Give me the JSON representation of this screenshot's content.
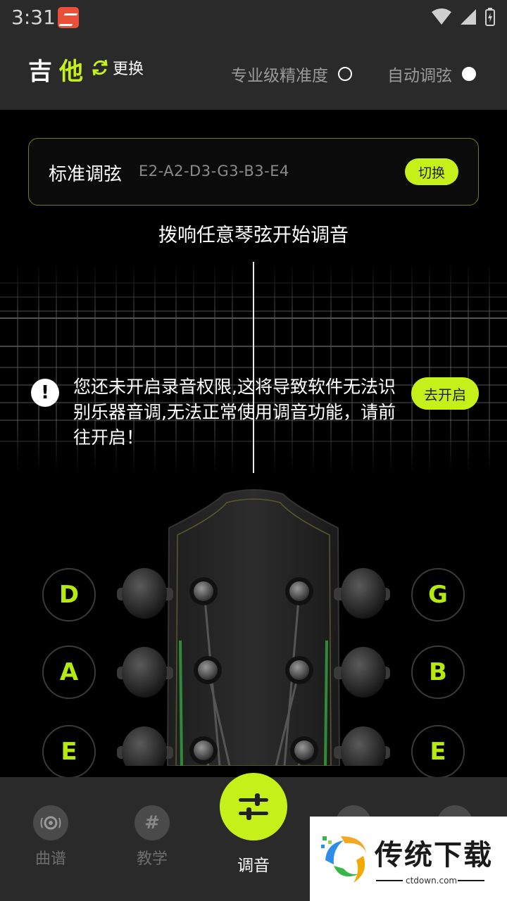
{
  "status_bar": {
    "time": "3:31"
  },
  "header": {
    "instrument_char1": "吉",
    "instrument_char2": "他",
    "swap_label": "更换",
    "option_pro": "专业级精准度",
    "option_auto": "自动调弦"
  },
  "tuning": {
    "name": "标准调弦",
    "notes": "E2-A2-D3-G3-B3-E4",
    "switch_label": "切换"
  },
  "prompt": "拨响任意琴弦开始调音",
  "warning": {
    "text": "您还未开启录音权限,这将导致软件无法识别乐器音调,无法正常使用调音功能，请前往开启！",
    "button": "去开启"
  },
  "strings": {
    "left": [
      "D",
      "A",
      "E"
    ],
    "right": [
      "G",
      "B",
      "E"
    ]
  },
  "nav": {
    "items": [
      {
        "label": "曲谱",
        "icon": "disc-icon"
      },
      {
        "label": "教学",
        "icon": "hash-icon"
      },
      {
        "label": "调音",
        "icon": "tuner-icon"
      }
    ]
  },
  "watermark": {
    "title": "传统下载",
    "url": "ctdown.com"
  },
  "colors": {
    "accent": "#c6f01a",
    "panel": "#2a2a2a"
  }
}
